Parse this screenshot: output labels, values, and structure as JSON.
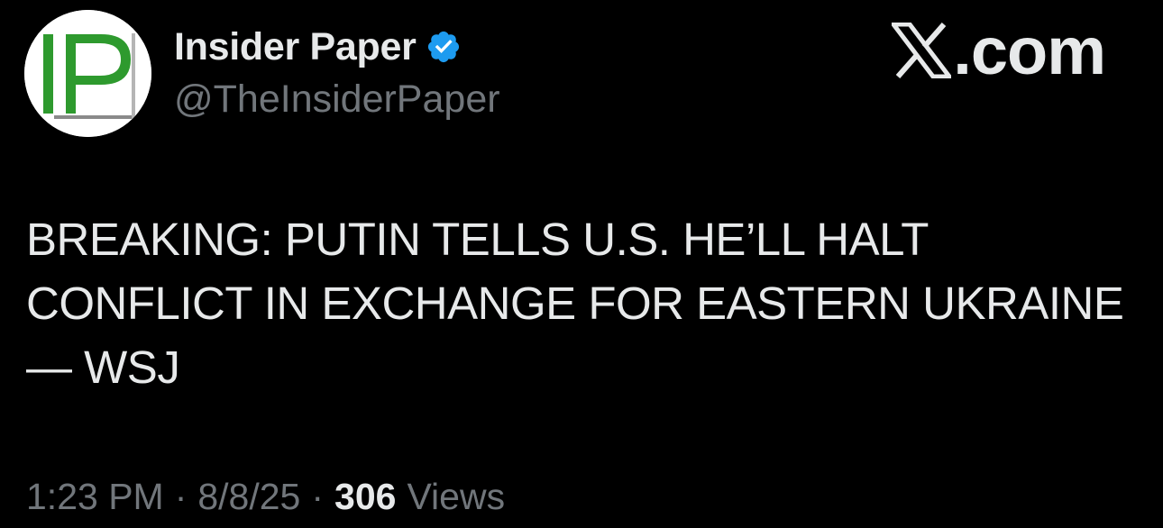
{
  "post": {
    "author": {
      "name": "Insider Paper",
      "handle": "@TheInsiderPaper",
      "verified": true,
      "avatar_icon": "insider-paper-logo",
      "avatar_text": "IP"
    },
    "brand": {
      "icon": "x-logo-icon",
      "text": ".com"
    },
    "text_lines": [
      "BREAKING: PUTIN TELLS U.S. HE’LL HALT",
      "CONFLICT IN EXCHANGE FOR EASTERN UKRAINE",
      "— WSJ"
    ],
    "meta": {
      "time": "1:23 PM",
      "date": "8/8/25",
      "separator": "·",
      "views_count": "306",
      "views_label": "Views"
    }
  },
  "colors": {
    "background": "#000000",
    "primary_text": "#e7e9ea",
    "secondary_text": "#71767b",
    "verified_blue": "#1d9bf0",
    "logo_green": "#2e9a2e"
  }
}
